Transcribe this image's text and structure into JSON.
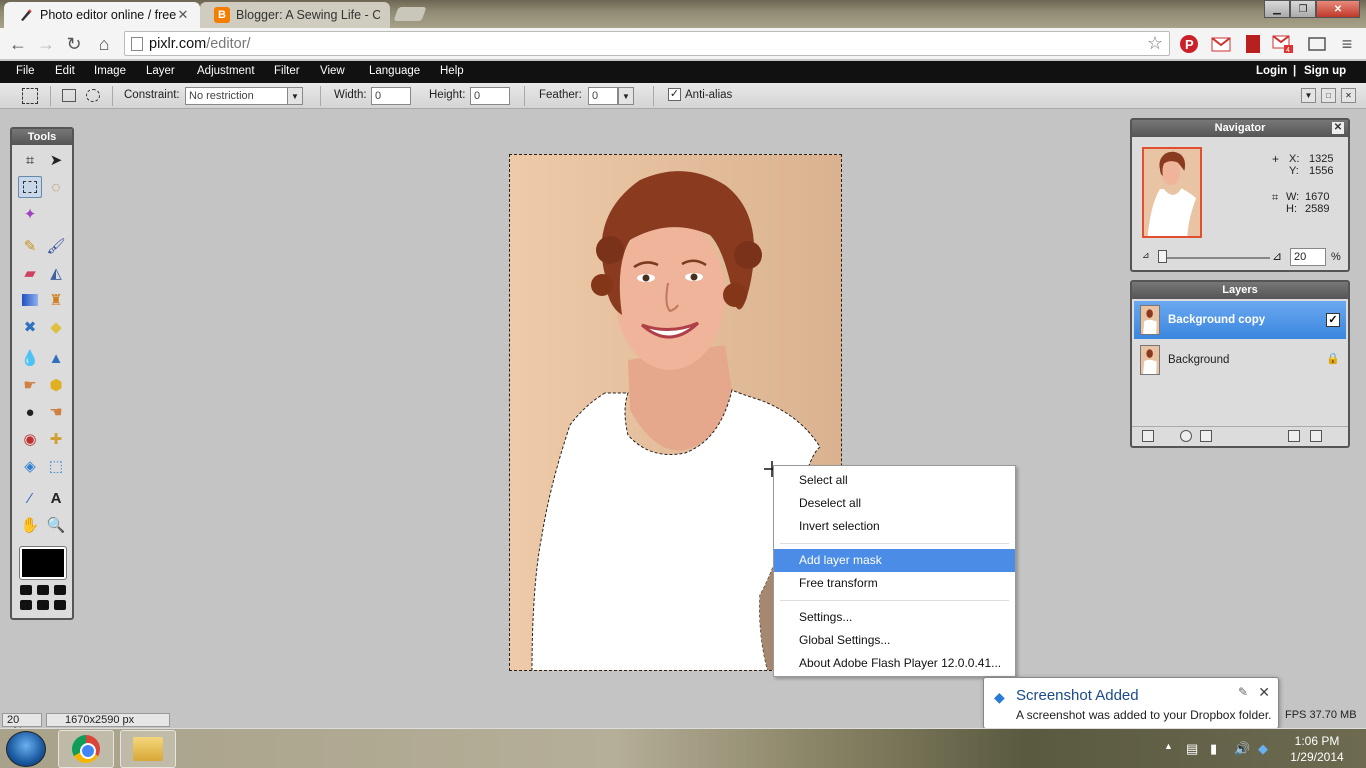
{
  "browser": {
    "tabs": [
      {
        "title": "Photo editor online / free",
        "active": true
      },
      {
        "title": "Blogger: A Sewing Life - C",
        "active": false
      }
    ],
    "url_host": "pixlr.com",
    "url_path": "/editor/"
  },
  "menu": {
    "items": [
      "File",
      "Edit",
      "Image",
      "Layer",
      "Adjustment",
      "Filter",
      "View",
      "Language",
      "Help"
    ],
    "login": "Login",
    "separator": "|",
    "signup": "Sign up"
  },
  "options": {
    "constraint_label": "Constraint:",
    "constraint_value": "No restriction",
    "width_label": "Width:",
    "width_value": "0",
    "height_label": "Height:",
    "height_value": "0",
    "feather_label": "Feather:",
    "feather_value": "0",
    "antialias_label": "Anti-alias",
    "antialias_checked": true
  },
  "tools_panel": {
    "title": "Tools",
    "foreground_color": "#000000"
  },
  "navigator": {
    "title": "Navigator",
    "x_label": "X:",
    "x_value": "1325",
    "y_label": "Y:",
    "y_value": "1556",
    "w_label": "W:",
    "w_value": "1670",
    "h_label": "H:",
    "h_value": "2589",
    "zoom_value": "20",
    "zoom_unit": "%"
  },
  "layers_panel": {
    "title": "Layers",
    "layers": [
      {
        "name": "Background copy",
        "selected": true,
        "state": "visible-check"
      },
      {
        "name": "Background",
        "selected": false,
        "state": "locked"
      }
    ]
  },
  "context_menu": {
    "items": [
      {
        "label": "Select all"
      },
      {
        "label": "Deselect all"
      },
      {
        "label": "Invert selection"
      },
      {
        "label": "Add layer mask",
        "highlighted": true
      },
      {
        "label": "Free transform"
      },
      {
        "label": "Settings..."
      },
      {
        "label": "Global Settings..."
      },
      {
        "label": "About Adobe Flash Player 12.0.0.41..."
      }
    ]
  },
  "statusbar": {
    "zoom": "20",
    "zoom_unit": "%",
    "dimensions": "1670x2590 px",
    "fps": "FPS 37.70 MB"
  },
  "toast": {
    "title": "Screenshot Added",
    "message": "A screenshot was added to your Dropbox folder."
  },
  "taskbar": {
    "time": "1:06 PM",
    "date": "1/29/2014"
  },
  "colors": {
    "menu_bar": "#111111",
    "highlight": "#4a8ce6",
    "layer_selected": "#3a86e0",
    "canvas_bg": "#c4c4c4"
  }
}
